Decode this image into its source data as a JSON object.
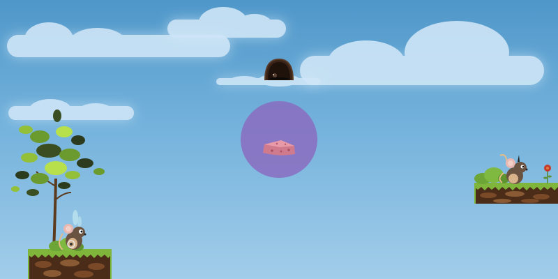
{
  "scene": {
    "sky_top_color": "#4f97c9",
    "sky_bottom_color": "#a2cdea",
    "bubble_color": "#8a6cc0",
    "elements": {
      "mouse_hole": "mouse-hole",
      "cheese": "cheese-icon",
      "tree": "tree",
      "player": "mouse-with-wings",
      "enemy": "mouse",
      "flower": "flower"
    }
  }
}
